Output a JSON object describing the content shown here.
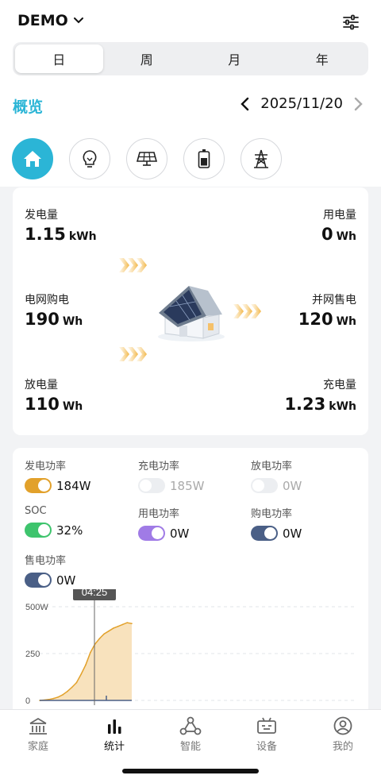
{
  "header": {
    "site_name": "DEMO",
    "tabs": [
      "日",
      "周",
      "月",
      "年"
    ],
    "active_tab": 0
  },
  "overview": {
    "title": "概览",
    "date": "2025/11/20",
    "icons": [
      "home-icon",
      "bulb-icon",
      "solar-panel-icon",
      "battery-icon",
      "grid-tower-icon"
    ],
    "accent": "#2bb5d6"
  },
  "energy": {
    "generation": {
      "label": "发电量",
      "value": "1.15",
      "unit": "kWh"
    },
    "consumption": {
      "label": "用电量",
      "value": "0",
      "unit": "Wh"
    },
    "grid_purchase": {
      "label": "电网购电",
      "value": "190",
      "unit": "Wh"
    },
    "grid_sale": {
      "label": "并网售电",
      "value": "120",
      "unit": "Wh"
    },
    "discharge": {
      "label": "放电量",
      "value": "110",
      "unit": "Wh"
    },
    "charge": {
      "label": "充电量",
      "value": "1.23",
      "unit": "kWh"
    }
  },
  "power": {
    "gen_power": {
      "label": "发电功率",
      "value": "184W",
      "on": true,
      "color": "#e2a12b"
    },
    "charge_power": {
      "label": "充电功率",
      "value": "185W",
      "on": false,
      "color": "#eceef1"
    },
    "discharge_power": {
      "label": "放电功率",
      "value": "0W",
      "on": false,
      "color": "#eceef1"
    },
    "soc": {
      "label": "SOC",
      "value": "32%",
      "on": true,
      "color": "#3ec46d"
    },
    "use_power": {
      "label": "用电功率",
      "value": "0W",
      "on": true,
      "color": "#a07be6"
    },
    "buy_power": {
      "label": "购电功率",
      "value": "0W",
      "on": true,
      "color": "#4a5f86"
    },
    "sell_power": {
      "label": "售电功率",
      "value": "0W",
      "on": true,
      "color": "#4a5f86"
    }
  },
  "chart_data": {
    "type": "area",
    "tooltip": "04:25",
    "y_ticks": [
      "500W",
      "250",
      "0"
    ],
    "ylim": [
      0,
      500
    ],
    "series": [
      {
        "color": "#e2a12b",
        "x": [
          0,
          1,
          2,
          3,
          4,
          5,
          6,
          7,
          8,
          9,
          10,
          11,
          12,
          13,
          14,
          15,
          16,
          17,
          18,
          19,
          20
        ],
        "values": [
          0,
          2,
          5,
          10,
          18,
          30,
          48,
          70,
          95,
          140,
          190,
          255,
          300,
          330,
          355,
          370,
          385,
          395,
          405,
          415,
          410
        ]
      }
    ]
  },
  "tabbar": {
    "items": [
      {
        "label": "家庭",
        "icon": "house-icon"
      },
      {
        "label": "统计",
        "icon": "bar-chart-icon"
      },
      {
        "label": "智能",
        "icon": "nodes-icon"
      },
      {
        "label": "设备",
        "icon": "device-icon"
      },
      {
        "label": "我的",
        "icon": "user-icon"
      }
    ],
    "active": 1
  }
}
